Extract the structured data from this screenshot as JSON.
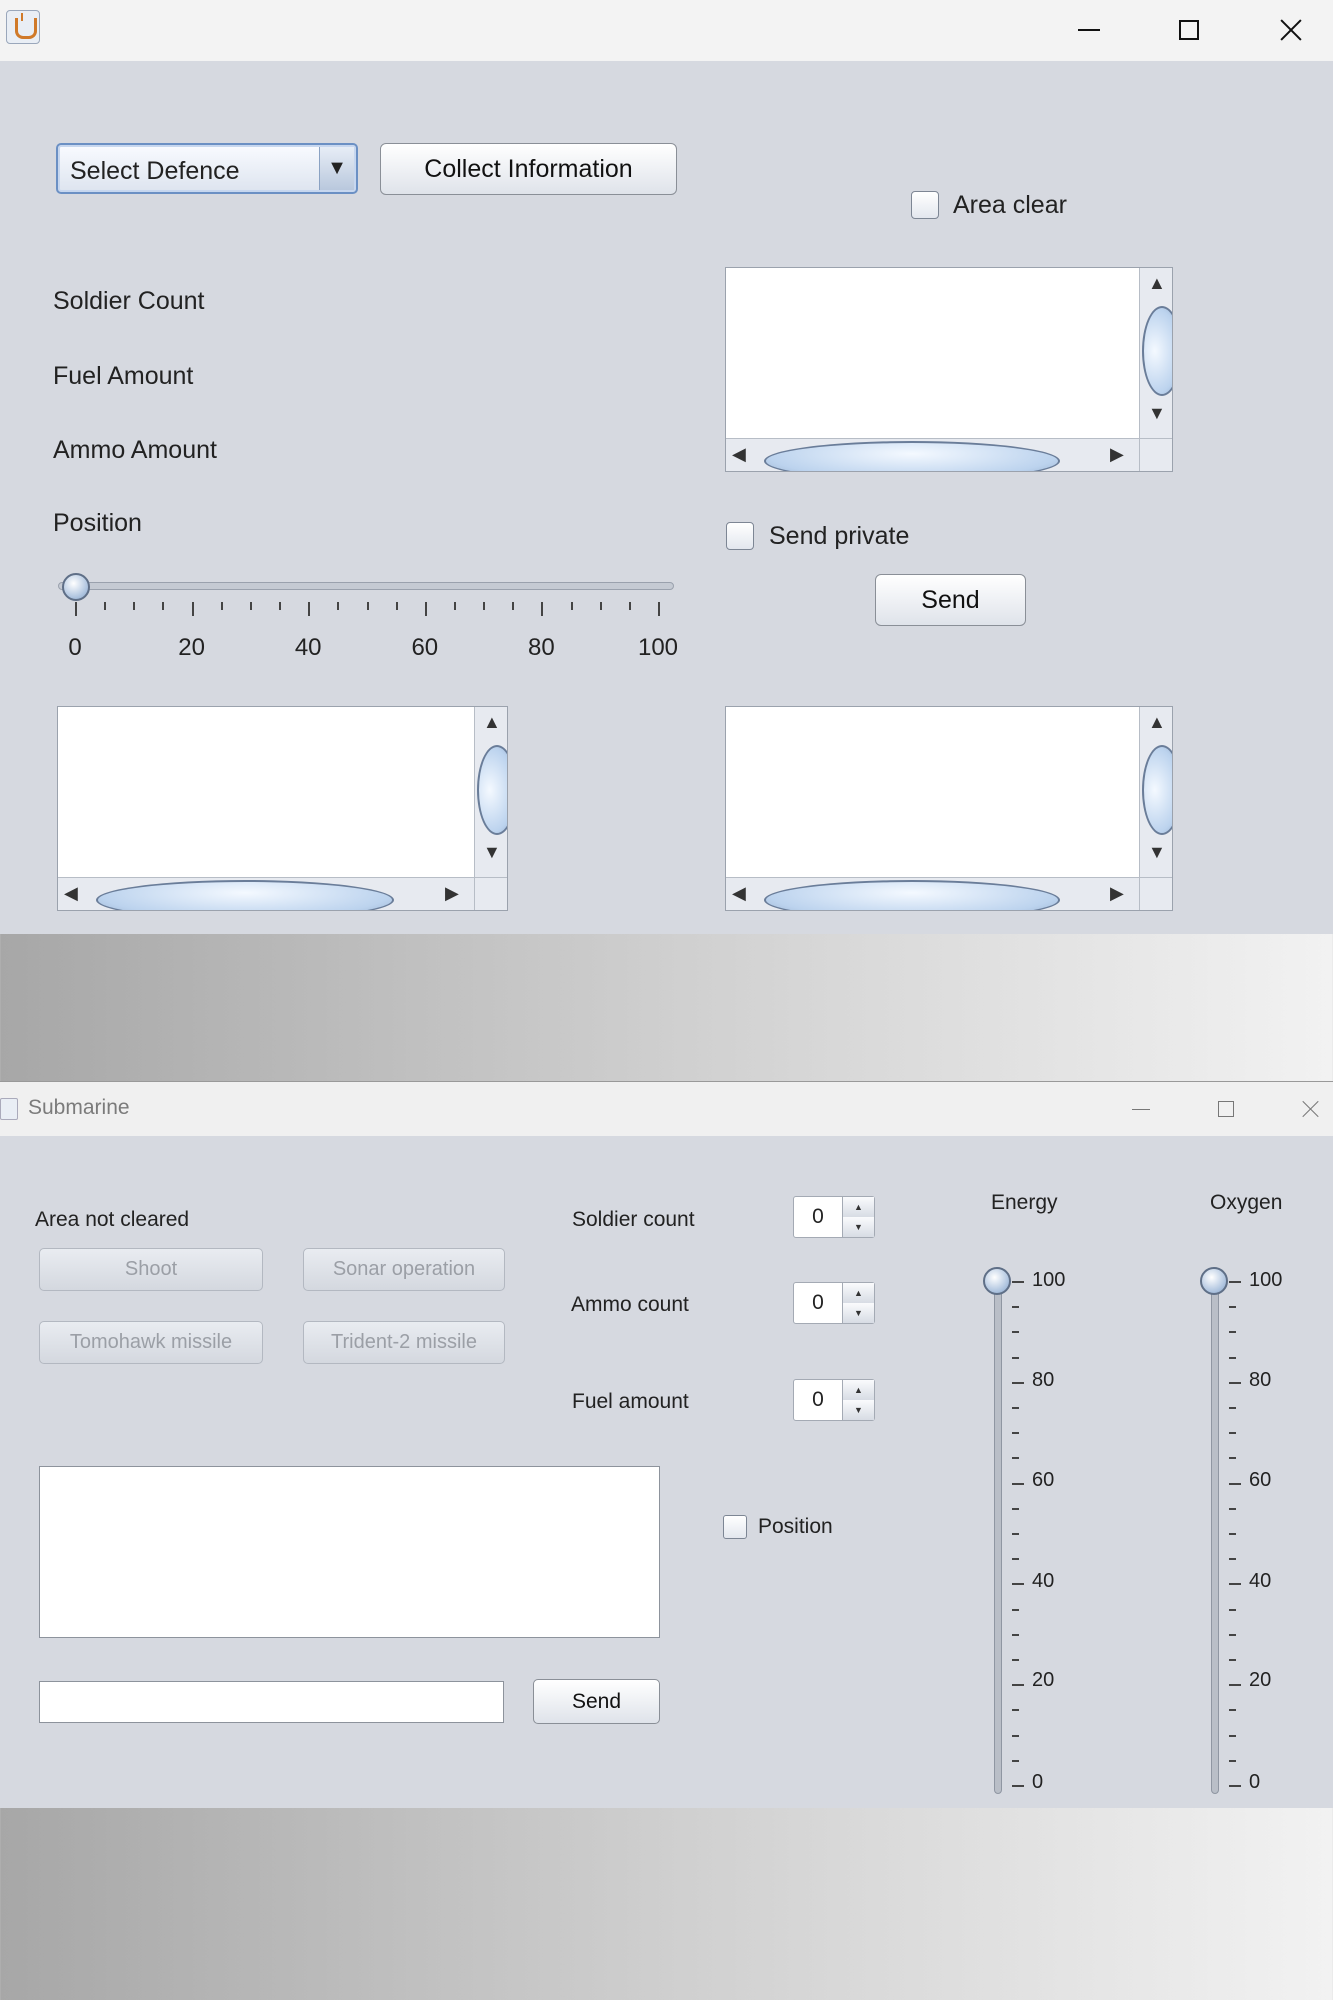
{
  "window1": {
    "controls": {
      "minimize_icon": "minimize-icon",
      "maximize_icon": "maximize-icon",
      "close_icon": "close-icon"
    },
    "select_defence": {
      "value": "Select Defence",
      "arrow": "▼"
    },
    "collect_button": "Collect Information",
    "area_clear": {
      "label": "Area clear",
      "checked": false
    },
    "labels": {
      "soldier_count": "Soldier Count",
      "fuel_amount": "Fuel Amount",
      "ammo_amount": "Ammo Amount",
      "position": "Position"
    },
    "position_slider": {
      "value": 0,
      "min": 0,
      "max": 100,
      "tick_labels": [
        "0",
        "20",
        "40",
        "60",
        "80",
        "100"
      ]
    },
    "send_private": {
      "label": "Send private",
      "checked": false
    },
    "send_button": "Send",
    "scroll_arrows": {
      "up": "▲",
      "down": "▼",
      "left": "◀",
      "right": "▶"
    }
  },
  "window2": {
    "title": "Submarine",
    "area_status": "Area not cleared",
    "buttons": {
      "shoot": "Shoot",
      "sonar": "Sonar operation",
      "tomahawk": "Tomohawk missile",
      "trident": "Trident-2 missile",
      "send": "Send"
    },
    "spinners": {
      "soldier_count": {
        "label": "Soldier count",
        "value": "0"
      },
      "ammo_count": {
        "label": "Ammo count",
        "value": "0"
      },
      "fuel_amount": {
        "label": "Fuel amount",
        "value": "0"
      }
    },
    "position": {
      "label": "Position",
      "checked": false
    },
    "message_input": {
      "value": ""
    },
    "energy": {
      "label": "Energy",
      "value": 100,
      "min": 0,
      "max": 100,
      "tick_labels": [
        "100",
        "80",
        "60",
        "40",
        "20",
        "0"
      ]
    },
    "oxygen": {
      "label": "Oxygen",
      "value": 100,
      "min": 0,
      "max": 100,
      "tick_labels": [
        "100",
        "80",
        "60",
        "40",
        "20",
        "0"
      ]
    },
    "spinner_arrows": {
      "up": "▲",
      "down": "▼"
    }
  }
}
